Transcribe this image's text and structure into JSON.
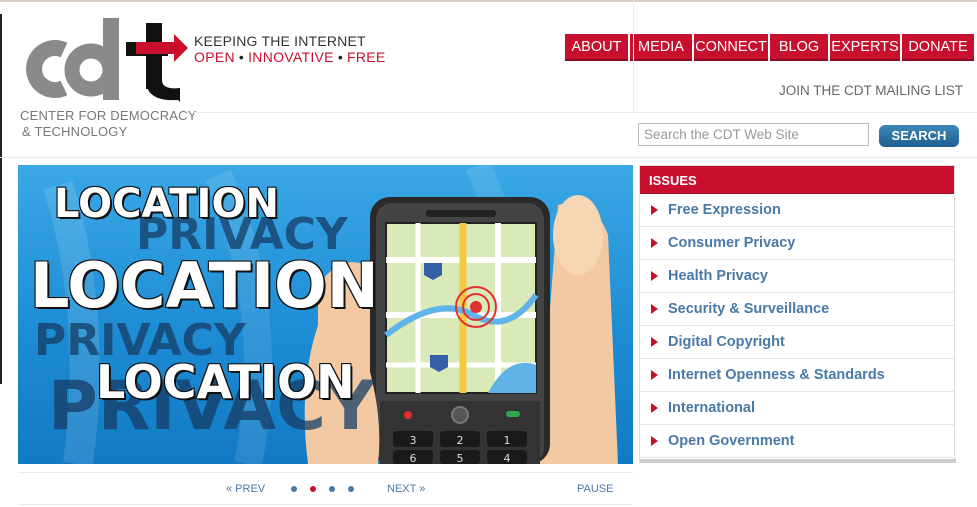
{
  "brand": {
    "logo_text": "cdt",
    "subtitle_line1": "CENTER FOR DEMOCRACY",
    "subtitle_line2": "& TECHNOLOGY",
    "tagline_line1": "KEEPING THE INTERNET",
    "tagline_words": [
      "OPEN",
      "INNOVATIVE",
      "FREE"
    ],
    "accent_color": "#c8102e"
  },
  "nav": {
    "items": [
      "ABOUT",
      "MEDIA",
      "CONNECT",
      "BLOG",
      "EXPERTS",
      "DONATE"
    ]
  },
  "mailing_list": "JOIN THE CDT MAILING LIST",
  "search": {
    "placeholder": "Search the CDT Web Site",
    "button": "SEARCH"
  },
  "hero": {
    "words": [
      "LOCATION",
      "PRIVACY",
      "LOCATION",
      "PRIVACY",
      "LOCATION",
      "PRIVACY"
    ],
    "keypad": [
      "3",
      "2",
      "1",
      "6",
      "5",
      "4"
    ]
  },
  "slider": {
    "prev": "« PREV",
    "next": "NEXT »",
    "pause": "PAUSE",
    "dots": 4,
    "active_dot": 2
  },
  "issues": {
    "title": "ISSUES",
    "items": [
      "Free Expression",
      "Consumer Privacy",
      "Health Privacy",
      "Security & Surveillance",
      "Digital Copyright",
      "Internet Openness & Standards",
      "International",
      "Open Government"
    ]
  }
}
